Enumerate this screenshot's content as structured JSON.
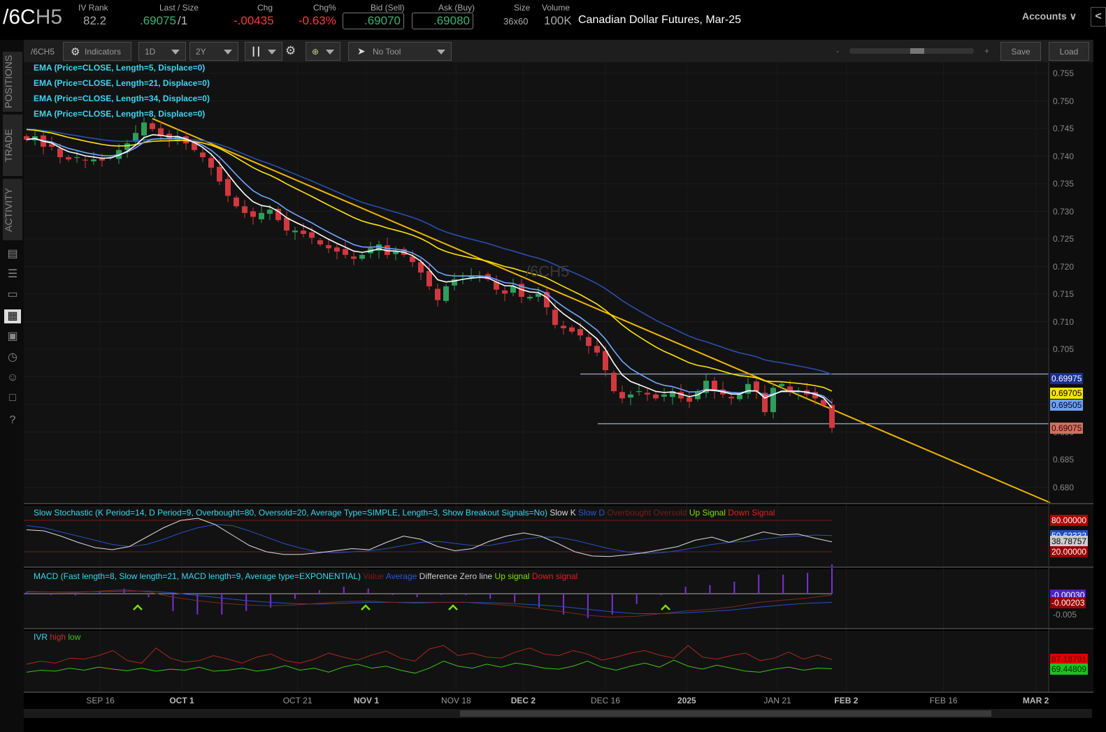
{
  "header": {
    "symbol_a": "/6C",
    "symbol_b": "H5",
    "iv_rank_label": "IV Rank",
    "iv_rank": "82.2",
    "last_label": "Last / Size",
    "last": ".69075",
    "size": "/1",
    "chg_label": "Chg",
    "chg": "-.00435",
    "chgp_label": "Chg%",
    "chgp": "-0.63%",
    "bid_label": "Bid (Sell)",
    "bid": ".69070",
    "ask_label": "Ask (Buy)",
    "ask": ".69080",
    "sz_label": "Size",
    "sz": "36x60",
    "vol_label": "Volume",
    "vol": "100K",
    "description": "Canadian Dollar Futures, Mar-25",
    "accounts": "Accounts"
  },
  "toolbar": {
    "symbol": "/6CH5",
    "indicators": "Indicators",
    "aggregation": "1D",
    "timeframe": "2Y",
    "tool": "No Tool",
    "zoom_minus": "-",
    "zoom_plus": "+",
    "save": "Save",
    "load": "Load",
    "zoom_level": 0.55
  },
  "sidebar": {
    "tabs": [
      "POSITIONS",
      "TRADE",
      "ACTIVITY"
    ]
  },
  "watermark": "/6CH5",
  "studies": {
    "ema": [
      "EMA (Price=CLOSE, Length=5, Displace=0)",
      "EMA (Price=CLOSE, Length=21, Displace=0)",
      "EMA (Price=CLOSE, Length=34, Displace=0)",
      "EMA (Price=CLOSE, Length=8, Displace=0)"
    ],
    "stoch": {
      "title": "Slow Stochastic (K Period=14, D Period=9, Overbought=80, Oversold=20, Average Type=SIMPLE, Length=3, Show Breakout Signals=No)",
      "legend": [
        "Slow K",
        "Slow D",
        "Overbought",
        "Oversold",
        "Up Signal",
        "Down Signal"
      ]
    },
    "macd": {
      "title": "MACD (Fast length=8, Slow length=21, MACD length=9, Average type=EXPONENTIAL)",
      "legend": [
        "Value",
        "Average",
        "Difference",
        "Zero line",
        "Up signal",
        "Down signal"
      ]
    },
    "ivr": {
      "title": "IVR",
      "legend": [
        "high",
        "low"
      ]
    }
  },
  "tags": {
    "ema34": "0.69975",
    "ema21": "0.69705",
    "ema8": "0.69505",
    "last": "0.69075",
    "ob": "80.00000",
    "k": "38.78757",
    "os": "20.00000",
    "d": "50.62332",
    "macd_val": "-0.00030",
    "macd_avg": "-0.00203",
    "ivr_high": "87.18791",
    "ivr_low": "69.44809"
  },
  "colors": {
    "up": "#2e9e5a",
    "down": "#d0393f",
    "ema5": "#ffffff",
    "ema8": "#6fa8ff",
    "ema21": "#ffe600",
    "ema34": "#2a4fb0",
    "trend": "#ff9d1e"
  },
  "chart_data": [
    {
      "type": "candlestick",
      "title": "/6CH5 Daily",
      "ylim": [
        0.6775,
        0.757
      ],
      "yticks": [
        0.755,
        0.75,
        0.745,
        0.74,
        0.735,
        0.73,
        0.725,
        0.72,
        0.715,
        0.71,
        0.705,
        0.7,
        0.695,
        0.69,
        0.685,
        0.68
      ],
      "xticks": [
        {
          "label": "SEP 16",
          "slot": 8.8
        },
        {
          "label": "OCT 1",
          "slot": 18.5,
          "bold": true
        },
        {
          "label": "OCT 21",
          "slot": 32.3
        },
        {
          "label": "NOV 1",
          "slot": 40.5,
          "bold": true
        },
        {
          "label": "NOV 18",
          "slot": 51.2
        },
        {
          "label": "DEC 2",
          "slot": 59.2,
          "bold": true
        },
        {
          "label": "DEC 16",
          "slot": 69
        },
        {
          "label": "2025",
          "slot": 78.7,
          "bold": true
        },
        {
          "label": "JAN 21",
          "slot": 89.5
        },
        {
          "label": "FEB 2",
          "slot": 97.7,
          "bold": true
        },
        {
          "label": "FEB 16",
          "slot": 109.3
        },
        {
          "label": "MAR 2",
          "slot": 120.3,
          "bold": true
        }
      ],
      "close": [
        0.743,
        0.7436,
        0.7417,
        0.7417,
        0.7398,
        0.7394,
        0.7398,
        0.7392,
        0.7394,
        0.7392,
        0.7398,
        0.7411,
        0.7423,
        0.7442,
        0.7461,
        0.7449,
        0.7436,
        0.743,
        0.7436,
        0.7423,
        0.7411,
        0.7398,
        0.7379,
        0.7354,
        0.7328,
        0.7309,
        0.7297,
        0.729,
        0.7297,
        0.7303,
        0.7284,
        0.7265,
        0.7265,
        0.7259,
        0.7252,
        0.724,
        0.7233,
        0.7227,
        0.7221,
        0.7214,
        0.7221,
        0.7233,
        0.724,
        0.7221,
        0.7227,
        0.7221,
        0.7208,
        0.7189,
        0.7164,
        0.7139,
        0.7164,
        0.7177,
        0.7183,
        0.7183,
        0.7183,
        0.7177,
        0.7158,
        0.7151,
        0.7164,
        0.7145,
        0.7145,
        0.7151,
        0.7126,
        0.7094,
        0.7088,
        0.7082,
        0.7075,
        0.7056,
        0.7044,
        0.7012,
        0.6974,
        0.6961,
        0.6968,
        0.6974,
        0.6968,
        0.6961,
        0.6968,
        0.6974,
        0.6961,
        0.6955,
        0.6974,
        0.6993,
        0.6974,
        0.6968,
        0.6961,
        0.6968,
        0.6987,
        0.6974,
        0.6936,
        0.698,
        0.6987,
        0.6974,
        0.6974,
        0.6968,
        0.6961,
        0.6949,
        0.69075
      ],
      "hlines": [
        0.7005,
        0.6915
      ],
      "trendline": {
        "from": {
          "slot": 15,
          "price": 0.7468
        },
        "to": {
          "slot": 122,
          "price": 0.6772
        }
      }
    },
    {
      "type": "line",
      "title": "Slow Stochastic",
      "ylim": [
        0,
        100
      ],
      "levels": [
        80,
        20
      ],
      "slowK": [
        62,
        60,
        50,
        38,
        28,
        24,
        30,
        48,
        66,
        80,
        84,
        72,
        52,
        32,
        20,
        15,
        15,
        18,
        22,
        26,
        24,
        38,
        50,
        44,
        30,
        22,
        26,
        40,
        50,
        56,
        50,
        36,
        20,
        12,
        11,
        14,
        18,
        24,
        30,
        42,
        48,
        38,
        48,
        58,
        52,
        54,
        46,
        39
      ],
      "slowD": [
        70,
        66,
        58,
        50,
        42,
        34,
        30,
        34,
        44,
        56,
        66,
        72,
        70,
        60,
        48,
        36,
        27,
        20,
        18,
        20,
        22,
        26,
        32,
        38,
        40,
        36,
        32,
        32,
        38,
        44,
        48,
        48,
        42,
        34,
        26,
        20,
        17,
        18,
        22,
        28,
        34,
        38,
        40,
        44,
        48,
        50,
        52,
        51
      ]
    },
    {
      "type": "line",
      "title": "MACD",
      "ylim": [
        -0.007,
        0.003
      ],
      "value": [
        0.0005,
        0.0004,
        0.0003,
        0.0006,
        0.0009,
        0.0004,
        -0.0008,
        -0.0016,
        -0.0022,
        -0.0026,
        -0.0028,
        -0.0026,
        -0.0022,
        -0.0018,
        -0.0017,
        -0.002,
        -0.0022,
        -0.002,
        -0.002,
        -0.0024,
        -0.0028,
        -0.0034,
        -0.0042,
        -0.005,
        -0.0054,
        -0.0052,
        -0.0046,
        -0.004,
        -0.0036,
        -0.003,
        -0.002,
        -0.0015,
        -0.001,
        -0.0003
      ],
      "average": [
        0.0004,
        0.0004,
        0.0004,
        0.0005,
        0.0006,
        0.0006,
        0.0002,
        -0.0004,
        -0.001,
        -0.0016,
        -0.002,
        -0.0023,
        -0.0024,
        -0.0022,
        -0.002,
        -0.002,
        -0.002,
        -0.002,
        -0.002,
        -0.0021,
        -0.0023,
        -0.0026,
        -0.003,
        -0.0036,
        -0.0042,
        -0.0046,
        -0.0046,
        -0.0044,
        -0.0041,
        -0.0037,
        -0.0031,
        -0.0026,
        -0.0022,
        -0.002
      ]
    },
    {
      "type": "line",
      "title": "IVR",
      "ylim": [
        0,
        120
      ],
      "yticks": [
        100,
        50
      ],
      "high": [
        78,
        84,
        80,
        90,
        88,
        95,
        105,
        85,
        80,
        110,
        90,
        82,
        85,
        95,
        88,
        80,
        92,
        98,
        85,
        80,
        88,
        100,
        92,
        86,
        96,
        104,
        90,
        84,
        108,
        115,
        95,
        100,
        92,
        90,
        102,
        110,
        98,
        95,
        105,
        98,
        86,
        92,
        100,
        105,
        96,
        90,
        115,
        92,
        88,
        95,
        100,
        85,
        90,
        102,
        88,
        96,
        87
      ],
      "low": [
        62,
        66,
        64,
        70,
        66,
        72,
        68,
        65,
        70,
        64,
        68,
        66,
        72,
        64,
        66,
        70,
        64,
        68,
        75,
        66,
        70,
        62,
        72,
        78,
        70,
        74,
        66,
        60,
        70,
        84,
        74,
        70,
        78,
        72,
        80,
        76,
        70,
        68,
        74,
        84,
        72,
        66,
        74,
        80,
        72,
        86,
        74,
        68,
        76,
        70,
        64,
        62,
        68,
        72,
        66,
        70,
        69
      ]
    }
  ]
}
